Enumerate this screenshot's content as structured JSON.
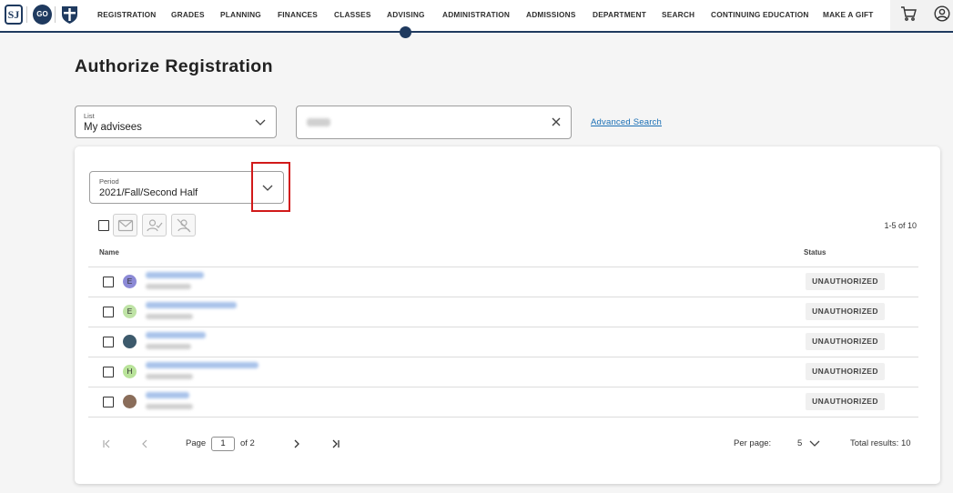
{
  "nav": {
    "logos": {
      "sj": "SJ",
      "go": "GO"
    },
    "items": [
      "REGISTRATION",
      "GRADES",
      "PLANNING",
      "FINANCES",
      "CLASSES",
      "ADVISING",
      "ADMINISTRATION",
      "ADMISSIONS",
      "DEPARTMENT",
      "SEARCH",
      "CONTINUING EDUCATION",
      "MAKE A GIFT"
    ],
    "active_item": "ADVISING",
    "icons": [
      "cart-icon",
      "user-account-icon"
    ]
  },
  "page": {
    "title": "Authorize Registration"
  },
  "filters": {
    "list_label": "List",
    "list_value": "My advisees",
    "search_value": "",
    "advanced_search": "Advanced Search"
  },
  "period": {
    "label": "Period",
    "value": "2021/Fall/Second Half"
  },
  "toolbar": {
    "range": "1-5 of 10",
    "icons": [
      "email-icon",
      "authorize-user-icon",
      "unauthorize-user-icon"
    ]
  },
  "table": {
    "headers": {
      "name": "Name",
      "status": "Status"
    },
    "rows": [
      {
        "avatar": "E",
        "avatar_color": "#8c8ad6",
        "status": "UNAUTHORIZED"
      },
      {
        "avatar": "E",
        "avatar_color": "#bfe3a6",
        "status": "UNAUTHORIZED"
      },
      {
        "avatar": "",
        "avatar_color": "#3d5a6c",
        "status": "UNAUTHORIZED"
      },
      {
        "avatar": "H",
        "avatar_color": "#b9e39a",
        "status": "UNAUTHORIZED"
      },
      {
        "avatar": "",
        "avatar_color": "#8a6d5a",
        "status": "UNAUTHORIZED"
      }
    ]
  },
  "pagination": {
    "page_label": "Page",
    "current_page": "1",
    "of_label": "of 2",
    "per_page_label": "Per page:",
    "per_page_value": "5",
    "total": "Total results: 10"
  },
  "colors": {
    "brand": "#1f3a5f",
    "link": "#1a6fb5",
    "highlight": "#d11a1a"
  }
}
